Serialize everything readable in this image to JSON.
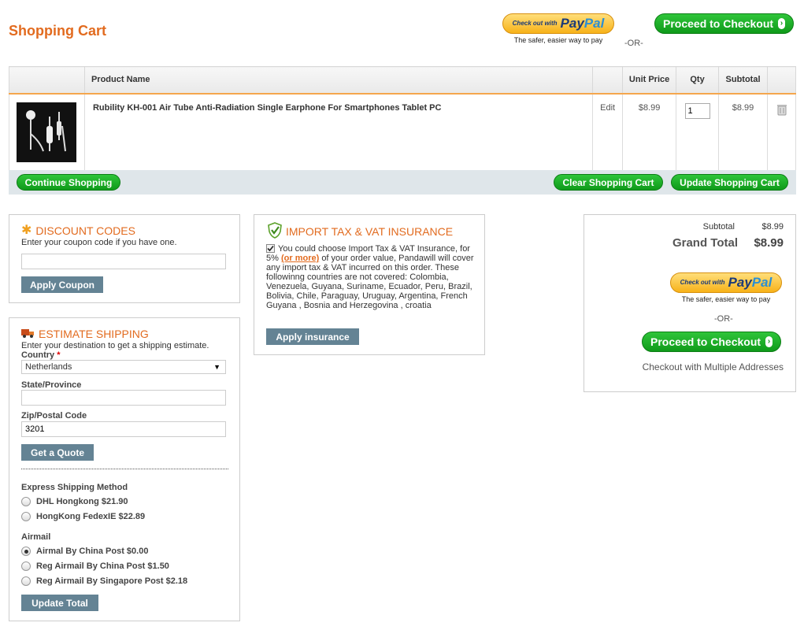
{
  "page": {
    "title": "Shopping Cart"
  },
  "top": {
    "paypal_small": "Check out with",
    "paypal_big_pay": "Pay",
    "paypal_big_pal": "Pal",
    "paypal_caption": "The safer, easier way to pay",
    "or": "-OR-",
    "checkout_label": "Proceed to Checkout"
  },
  "cart": {
    "columns": [
      "Product Name",
      "Unit Price",
      "Qty",
      "Subtotal"
    ],
    "item": {
      "name": "Rubility KH-001 Air Tube Anti-Radiation Single Earphone For Smartphones Tablet PC",
      "edit": "Edit",
      "unit_price": "$8.99",
      "qty": "1",
      "subtotal": "$8.99"
    },
    "continue_label": "Continue Shopping",
    "clear_label": "Clear Shopping Cart",
    "update_label": "Update Shopping Cart"
  },
  "discount": {
    "title": "DISCOUNT CODES",
    "subtitle": "Enter your coupon code if you have one.",
    "value": "",
    "button": "Apply Coupon"
  },
  "shipping": {
    "title": "ESTIMATE SHIPPING",
    "subtitle": "Enter your destination to get a shipping estimate.",
    "country_label": "Country",
    "required_mark": "*",
    "country_value": "Netherlands",
    "state_label": "State/Province",
    "state_value": "",
    "zip_label": "Zip/Postal Code",
    "zip_value": "3201",
    "quote_button": "Get a Quote",
    "express_label": "Express Shipping Method",
    "express_options": [
      {
        "label": "DHL Hongkong $21.90",
        "selected": false
      },
      {
        "label": "HongKong FedexIE $22.89",
        "selected": false
      }
    ],
    "airmail_label": "Airmail",
    "airmail_options": [
      {
        "label": "Airmal By China Post $0.00",
        "selected": true
      },
      {
        "label": "Reg Airmail By China Post $1.50",
        "selected": false
      },
      {
        "label": "Reg Airmail By Singapore Post $2.18",
        "selected": false
      }
    ],
    "update_button": "Update Total"
  },
  "insurance": {
    "title": "IMPORT TAX & VAT INSURANCE",
    "text_before": "You could choose Import Tax & VAT Insurance, for 5%",
    "link": "(or more)",
    "text_after": "of your order value, Pandawill will cover any import tax & VAT incurred on this order. These followinng countries are not covered: Colombia, Venezuela, Guyana, Suriname, Ecuador, Peru, Brazil, Bolivia, Chile, Paraguay, Uruguay, Argentina, French Guyana , Bosnia and Herzegovina , croatia",
    "checked": true,
    "button": "Apply insurance"
  },
  "totals": {
    "subtotal_label": "Subtotal",
    "subtotal_value": "$8.99",
    "grand_label": "Grand Total",
    "grand_value": "$8.99",
    "or": "-OR-",
    "checkout_label": "Proceed to Checkout",
    "multiple": "Checkout with Multiple Addresses"
  },
  "colors": {
    "accent": "#e26b1f",
    "green": "#13a51f",
    "slate": "#648394"
  }
}
